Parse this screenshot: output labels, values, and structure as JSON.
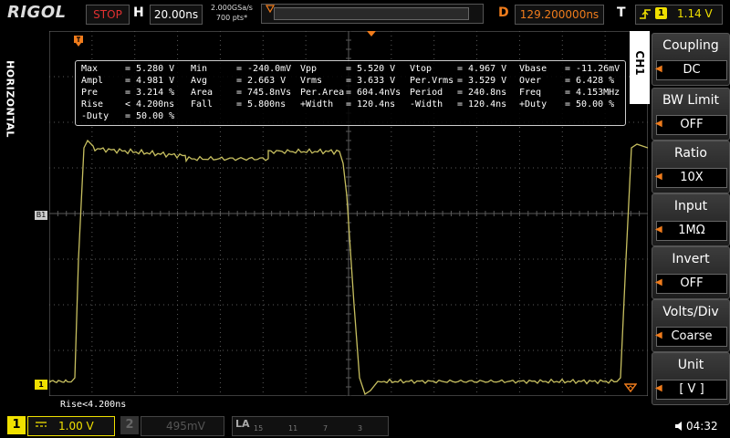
{
  "top": {
    "brand": "RIGOL",
    "run_status": "STOP",
    "horizontal_label": "H",
    "timebase": "20.00ns",
    "sample_rate": "2.000GSa/s",
    "mem_depth": "700 pts*",
    "delay_label": "D",
    "delay": "129.200000ns",
    "trigger_label": "T",
    "trigger_edge": "rising-edge-icon",
    "trigger_source": "1",
    "trigger_level": "1.14 V"
  },
  "side_label": "HORIZONTAL",
  "channel_tab": "CH1",
  "menu": [
    {
      "title": "Coupling",
      "value": "DC"
    },
    {
      "title": "BW Limit",
      "value": "OFF"
    },
    {
      "title": "Ratio",
      "value": "10X"
    },
    {
      "title": "Input",
      "value": "1MΩ"
    },
    {
      "title": "Invert",
      "value": "OFF"
    },
    {
      "title": "Volts/Div",
      "value": "Coarse"
    },
    {
      "title": "Unit",
      "value": "[ V ]"
    }
  ],
  "measurements": [
    [
      [
        "Max",
        "= 5.280 V"
      ],
      [
        "Min",
        "= -240.0mV"
      ],
      [
        "Vpp",
        "= 5.520 V"
      ],
      [
        "Vtop",
        "= 4.967 V"
      ],
      [
        "Vbase",
        "= -11.26mV"
      ]
    ],
    [
      [
        "Ampl",
        "= 4.981 V"
      ],
      [
        "Avg",
        "= 2.663 V"
      ],
      [
        "Vrms",
        "= 3.633 V"
      ],
      [
        "Per.Vrms",
        "= 3.529 V"
      ],
      [
        "Over",
        "= 6.428 %"
      ]
    ],
    [
      [
        "Pre",
        "= 3.214 %"
      ],
      [
        "Area",
        "= 745.8nVs"
      ],
      [
        "Per.Area",
        "= 604.4nVs"
      ],
      [
        "Period",
        "= 240.8ns"
      ],
      [
        "Freq",
        "= 4.153MHz"
      ]
    ],
    [
      [
        "Rise",
        "< 4.200ns"
      ],
      [
        "Fall",
        "= 5.800ns"
      ],
      [
        "+Width",
        "= 120.4ns"
      ],
      [
        "-Width",
        "= 120.4ns"
      ],
      [
        "+Duty",
        "= 50.00 %"
      ]
    ],
    [
      [
        "-Duty",
        "= 50.00 %"
      ]
    ]
  ],
  "screen": {
    "marker_b1": "B1",
    "marker_ch1": "1",
    "bottom_readout": "Rise<4.200ns"
  },
  "bottom": {
    "ch1_num": "1",
    "ch1_coupling": "DC",
    "ch1_scale": "1.00 V",
    "ch2_num": "2",
    "ch2_scale": "495mV",
    "la_label": "LA",
    "la_numbers": [
      "15",
      "11",
      "7",
      "3"
    ],
    "time": "04:32"
  },
  "colors": {
    "trace": "#c8c060",
    "ch1": "#f0e000",
    "accent": "#f07c1c",
    "grid": "#5a5a5a"
  }
}
